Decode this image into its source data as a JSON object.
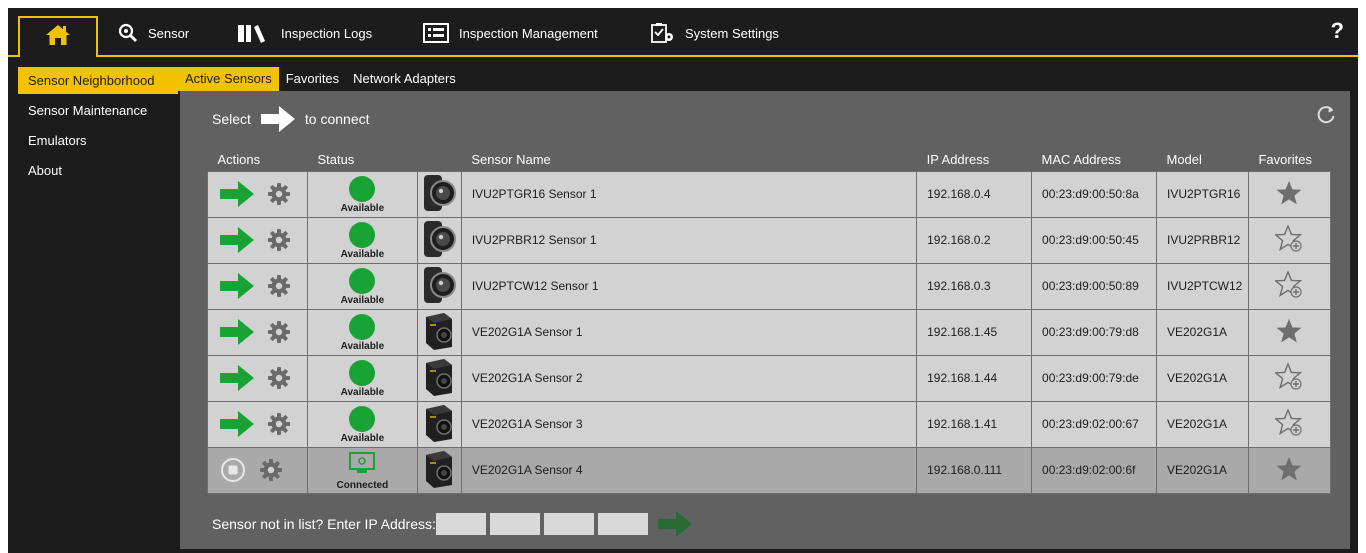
{
  "nav": {
    "home_icon": "home-icon",
    "items": [
      {
        "label": "Sensor",
        "icon": "sensor-search-icon"
      },
      {
        "label": "Inspection Logs",
        "icon": "books-icon"
      },
      {
        "label": "Inspection Management",
        "icon": "list-icon"
      },
      {
        "label": "System Settings",
        "icon": "settings-clipboard-icon"
      }
    ],
    "help": "?"
  },
  "sidebar": {
    "items": [
      {
        "label": "Sensor Neighborhood",
        "active": true
      },
      {
        "label": "Sensor Maintenance",
        "active": false
      },
      {
        "label": "Emulators",
        "active": false
      },
      {
        "label": "About",
        "active": false
      }
    ]
  },
  "tabs": [
    {
      "label": "Active Sensors",
      "active": true
    },
    {
      "label": "Favorites",
      "active": false
    },
    {
      "label": "Network Adapters",
      "active": false
    }
  ],
  "select_bar": {
    "select": "Select",
    "to_connect": "to connect"
  },
  "table": {
    "headers": {
      "actions": "Actions",
      "status": "Status",
      "name": "Sensor Name",
      "ip": "IP Address",
      "mac": "MAC Address",
      "model": "Model",
      "favorites": "Favorites"
    },
    "rows": [
      {
        "status": "Available",
        "name": "IVU2PTGR16 Sensor 1",
        "ip": "192.168.0.4",
        "mac": "00:23:d9:00:50:8a",
        "model": "IVU2PTGR16",
        "favorite": true,
        "camera": "round-camera",
        "connected": false
      },
      {
        "status": "Available",
        "name": "IVU2PRBR12 Sensor 1",
        "ip": "192.168.0.2",
        "mac": "00:23:d9:00:50:45",
        "model": "IVU2PRBR12",
        "favorite": false,
        "camera": "round-camera",
        "connected": false
      },
      {
        "status": "Available",
        "name": "IVU2PTCW12 Sensor 1",
        "ip": "192.168.0.3",
        "mac": "00:23:d9:00:50:89",
        "model": "IVU2PTCW12",
        "favorite": false,
        "camera": "round-camera",
        "connected": false
      },
      {
        "status": "Available",
        "name": "VE202G1A Sensor 1",
        "ip": "192.168.1.45",
        "mac": "00:23:d9:00:79:d8",
        "model": "VE202G1A",
        "favorite": true,
        "camera": "box-camera",
        "connected": false
      },
      {
        "status": "Available",
        "name": "VE202G1A Sensor 2",
        "ip": "192.168.1.44",
        "mac": "00:23:d9:00:79:de",
        "model": "VE202G1A",
        "favorite": false,
        "camera": "box-camera",
        "connected": false
      },
      {
        "status": "Available",
        "name": "VE202G1A Sensor 3",
        "ip": "192.168.1.41",
        "mac": "00:23:d9:02:00:67",
        "model": "VE202G1A",
        "favorite": false,
        "camera": "box-camera",
        "connected": false
      },
      {
        "status": "Connected",
        "name": "VE202G1A Sensor 4",
        "ip": "192.168.0.111",
        "mac": "00:23:d9:02:00:6f",
        "model": "VE202G1A",
        "favorite": true,
        "camera": "box-camera",
        "connected": true
      }
    ]
  },
  "bottom": {
    "label": "Sensor not in list?  Enter IP Address:"
  },
  "colors": {
    "accent": "#f2c200",
    "green": "#1aa335",
    "panel": "#616161",
    "background": "#1c1c1c"
  }
}
